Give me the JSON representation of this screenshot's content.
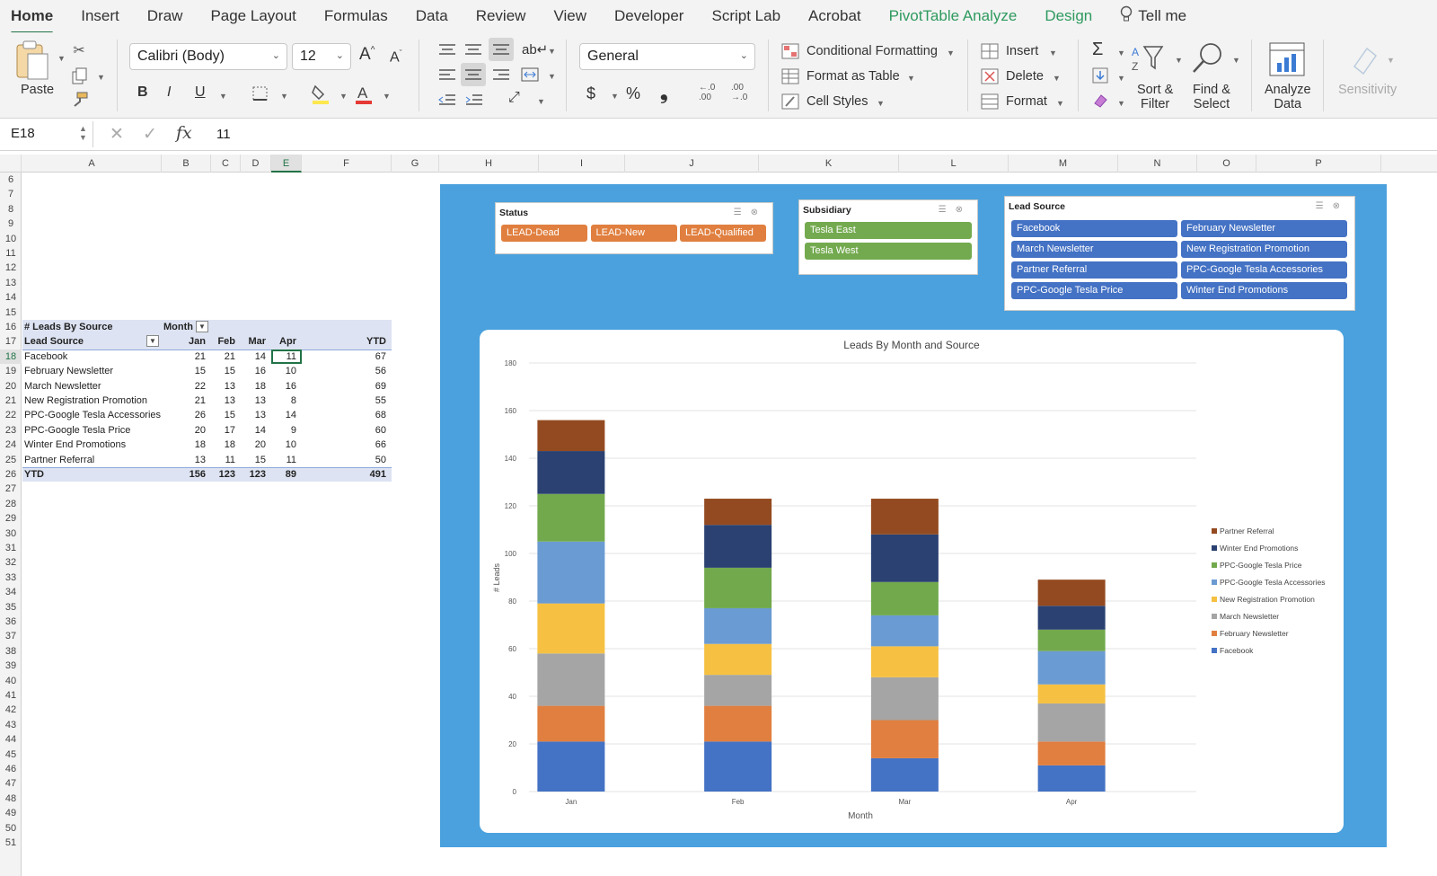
{
  "tabs": [
    {
      "label": "Home",
      "active": true
    },
    {
      "label": "Insert"
    },
    {
      "label": "Draw"
    },
    {
      "label": "Page Layout"
    },
    {
      "label": "Formulas"
    },
    {
      "label": "Data"
    },
    {
      "label": "Review"
    },
    {
      "label": "View"
    },
    {
      "label": "Developer"
    },
    {
      "label": "Script Lab"
    },
    {
      "label": "Acrobat"
    },
    {
      "label": "PivotTable Analyze",
      "contextual": true
    },
    {
      "label": "Design",
      "contextual": true
    }
  ],
  "tell_me": "Tell me",
  "ribbon": {
    "paste": "Paste",
    "font_name": "Calibri (Body)",
    "font_size": "12",
    "number_format": "General",
    "conditional_formatting": "Conditional Formatting",
    "format_as_table": "Format as Table",
    "cell_styles": "Cell Styles",
    "insert": "Insert",
    "delete": "Delete",
    "format": "Format",
    "sort_filter_1": "Sort &",
    "sort_filter_2": "Filter",
    "find_select_1": "Find &",
    "find_select_2": "Select",
    "analyze_1": "Analyze",
    "analyze_2": "Data",
    "sensitivity": "Sensitivity",
    "bold": "B",
    "italic": "I",
    "underline": "U",
    "currency": "$",
    "percent": "%",
    "comma": "❟",
    "inc_decimal": "←.0\n.00",
    "dec_decimal": ".00\n→.0"
  },
  "formula_bar": {
    "name_box": "E18",
    "fx": "fx",
    "value": "11"
  },
  "columns": [
    "A",
    "B",
    "C",
    "D",
    "E",
    "F",
    "G",
    "H",
    "I",
    "J",
    "K",
    "L",
    "M",
    "N",
    "O",
    "P"
  ],
  "selected_column": "E",
  "rows": [
    6,
    7,
    8,
    9,
    10,
    11,
    12,
    13,
    14,
    15,
    16,
    17,
    18,
    19,
    20,
    21,
    22,
    23,
    24,
    25,
    26,
    27,
    28,
    29,
    30,
    31,
    32,
    33,
    34,
    35,
    36,
    37,
    38,
    39,
    40,
    41,
    42,
    43,
    44,
    45,
    46,
    47,
    48,
    49,
    50,
    51
  ],
  "selected_row": 18,
  "pivot": {
    "title": "# Leads By Source",
    "col_field": "Month",
    "row_field": "Lead Source",
    "headers": [
      "Jan",
      "Feb",
      "Mar",
      "Apr",
      "YTD"
    ],
    "rows": [
      {
        "label": "Facebook",
        "values": [
          21,
          21,
          14,
          11,
          67
        ]
      },
      {
        "label": "February Newsletter",
        "values": [
          15,
          15,
          16,
          10,
          56
        ]
      },
      {
        "label": "March Newsletter",
        "values": [
          22,
          13,
          18,
          16,
          69
        ]
      },
      {
        "label": "New Registration Promotion",
        "values": [
          21,
          13,
          13,
          8,
          55
        ]
      },
      {
        "label": "PPC-Google Tesla Accessories",
        "values": [
          26,
          15,
          13,
          14,
          68
        ]
      },
      {
        "label": "PPC-Google Tesla Price",
        "values": [
          20,
          17,
          14,
          9,
          60
        ]
      },
      {
        "label": "Winter End Promotions",
        "values": [
          18,
          18,
          20,
          10,
          66
        ]
      },
      {
        "label": "Partner Referral",
        "values": [
          13,
          11,
          15,
          11,
          50
        ]
      }
    ],
    "total": {
      "label": "YTD",
      "values": [
        156,
        123,
        123,
        89,
        491
      ]
    }
  },
  "slicers": {
    "status": {
      "title": "Status",
      "items": [
        "LEAD-Dead",
        "LEAD-New",
        "LEAD-Qualified"
      ],
      "color": "#e07f3f"
    },
    "subsidiary": {
      "title": "Subsidiary",
      "items": [
        "Tesla East",
        "Tesla West"
      ],
      "color": "#73aa4f"
    },
    "lead_source": {
      "title": "Lead Source",
      "items": [
        "Facebook",
        "February Newsletter",
        "March Newsletter",
        "New Registration Promotion",
        "Partner Referral",
        "PPC-Google Tesla Accessories",
        "PPC-Google Tesla Price",
        "Winter End Promotions"
      ],
      "color": "#4472c4"
    }
  },
  "chart_data": {
    "type": "bar",
    "stacked": true,
    "title": "Leads By Month and Source",
    "xlabel": "Month",
    "ylabel": "# Leads",
    "ylim": [
      0,
      180
    ],
    "yticks": [
      0,
      20,
      40,
      60,
      80,
      100,
      120,
      140,
      160,
      180
    ],
    "categories": [
      "Jan",
      "Feb",
      "Mar",
      "Apr"
    ],
    "series": [
      {
        "name": "Facebook",
        "color": "#4472c4",
        "values": [
          21,
          21,
          14,
          11
        ]
      },
      {
        "name": "February Newsletter",
        "color": "#e07f3f",
        "values": [
          15,
          15,
          16,
          10
        ]
      },
      {
        "name": "March Newsletter",
        "color": "#a5a5a5",
        "values": [
          22,
          13,
          18,
          16
        ]
      },
      {
        "name": "New Registration Promotion",
        "color": "#f6c142",
        "values": [
          21,
          13,
          13,
          8
        ]
      },
      {
        "name": "PPC-Google Tesla Accessories",
        "color": "#6a9bd2",
        "values": [
          26,
          15,
          13,
          14
        ]
      },
      {
        "name": "PPC-Google Tesla Price",
        "color": "#72a94d",
        "values": [
          20,
          17,
          14,
          9
        ]
      },
      {
        "name": "Winter End Promotions",
        "color": "#2a4172",
        "values": [
          18,
          18,
          20,
          10
        ]
      },
      {
        "name": "Partner Referral",
        "color": "#944a20",
        "values": [
          13,
          11,
          15,
          11
        ]
      }
    ],
    "legend": "right"
  }
}
